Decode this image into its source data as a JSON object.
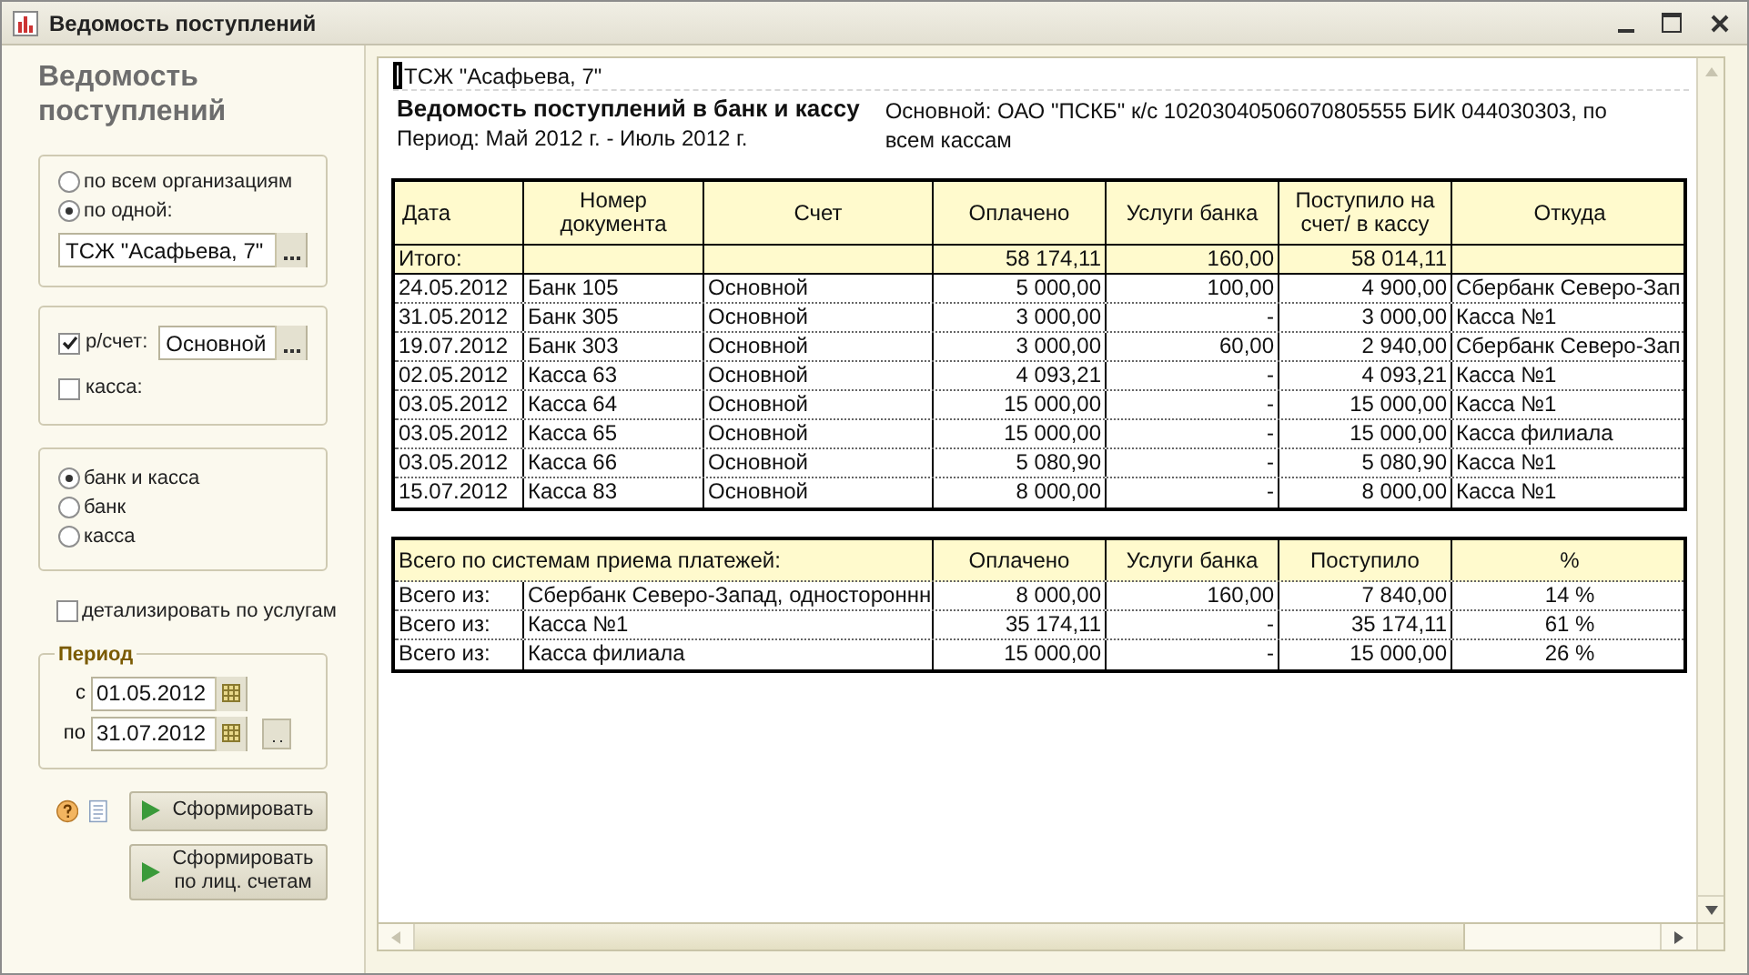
{
  "window": {
    "title": "Ведомость поступлений"
  },
  "sidebar": {
    "heading": "Ведомость поступлений",
    "org_options": [
      {
        "label": "по всем организациям",
        "selected": false
      },
      {
        "label": "по одной:",
        "selected": true
      }
    ],
    "org_field": {
      "value": "ТСЖ \"Асафьева, 7\""
    },
    "sources": [
      {
        "kind": "field",
        "label": "р/счет:",
        "checked": true,
        "value": "Основной"
      },
      {
        "kind": "plain",
        "label": "касса:",
        "checked": false
      }
    ],
    "modes": [
      {
        "label": "банк и касса",
        "selected": true
      },
      {
        "label": "банк",
        "selected": false
      },
      {
        "label": "касса",
        "selected": false
      }
    ],
    "detail": {
      "label": "детализировать по услугам",
      "checked": false
    },
    "period": {
      "title": "Период",
      "from_label": "с",
      "from": "01.05.2012",
      "to_label": "по",
      "to": "31.07.2012"
    },
    "buttons": [
      "Сформировать",
      "Сформировать по лиц. счетам"
    ]
  },
  "report": {
    "org": "ТСЖ \"Асафьева, 7\"",
    "title": "Ведомость поступлений в банк и кассу",
    "period": "Период: Май 2012 г. - Июль 2012 г.",
    "account_info": "Основной: ОАО \"ПСКБ\" к/с 10203040506070805555 БИК 044030303, по всем кассам",
    "table": {
      "columns": [
        "Дата",
        "Номер документа",
        "Счет",
        "Оплачено",
        "Услуги банка",
        "Поступило на счет/ в кассу",
        "Откуда"
      ],
      "total": {
        "label": "Итого:",
        "paid": "58 174,11",
        "bank_fee": "160,00",
        "received": "58 014,11"
      },
      "rows": [
        [
          "24.05.2012",
          "Банк 105",
          "Основной",
          "5 000,00",
          "100,00",
          "4 900,00",
          "Сбербанк Северо-Зап"
        ],
        [
          "31.05.2012",
          "Банк 305",
          "Основной",
          "3 000,00",
          "-",
          "3 000,00",
          "Касса №1"
        ],
        [
          "19.07.2012",
          "Банк 303",
          "Основной",
          "3 000,00",
          "60,00",
          "2 940,00",
          "Сбербанк Северо-Зап"
        ],
        [
          "02.05.2012",
          "Касса 63",
          "Основной",
          "4 093,21",
          "-",
          "4 093,21",
          "Касса №1"
        ],
        [
          "03.05.2012",
          "Касса 64",
          "Основной",
          "15 000,00",
          "-",
          "15 000,00",
          "Касса №1"
        ],
        [
          "03.05.2012",
          "Касса 65",
          "Основной",
          "15 000,00",
          "-",
          "15 000,00",
          "Касса филиала"
        ],
        [
          "03.05.2012",
          "Касса 66",
          "Основной",
          "5 080,90",
          "-",
          "5 080,90",
          "Касса №1"
        ],
        [
          "15.07.2012",
          "Касса 83",
          "Основной",
          "8 000,00",
          "-",
          "8 000,00",
          "Касса №1"
        ]
      ]
    },
    "summary": {
      "title": "Всего по системам приема платежей:",
      "columns": [
        "Оплачено",
        "Услуги банка",
        "Поступило",
        "%"
      ],
      "rows": [
        {
          "prefix": "Всего из:",
          "name": "Сбербанк Северо-Запад, одностороннн",
          "values": [
            "8 000,00",
            "160,00",
            "7 840,00",
            "14 %"
          ]
        },
        {
          "prefix": "Всего из:",
          "name": "Касса №1",
          "values": [
            "35 174,11",
            "-",
            "35 174,11",
            "61 %"
          ]
        },
        {
          "prefix": "Всего из:",
          "name": "Касса филиала",
          "values": [
            "15 000,00",
            "-",
            "15 000,00",
            "26 %"
          ]
        }
      ]
    }
  }
}
